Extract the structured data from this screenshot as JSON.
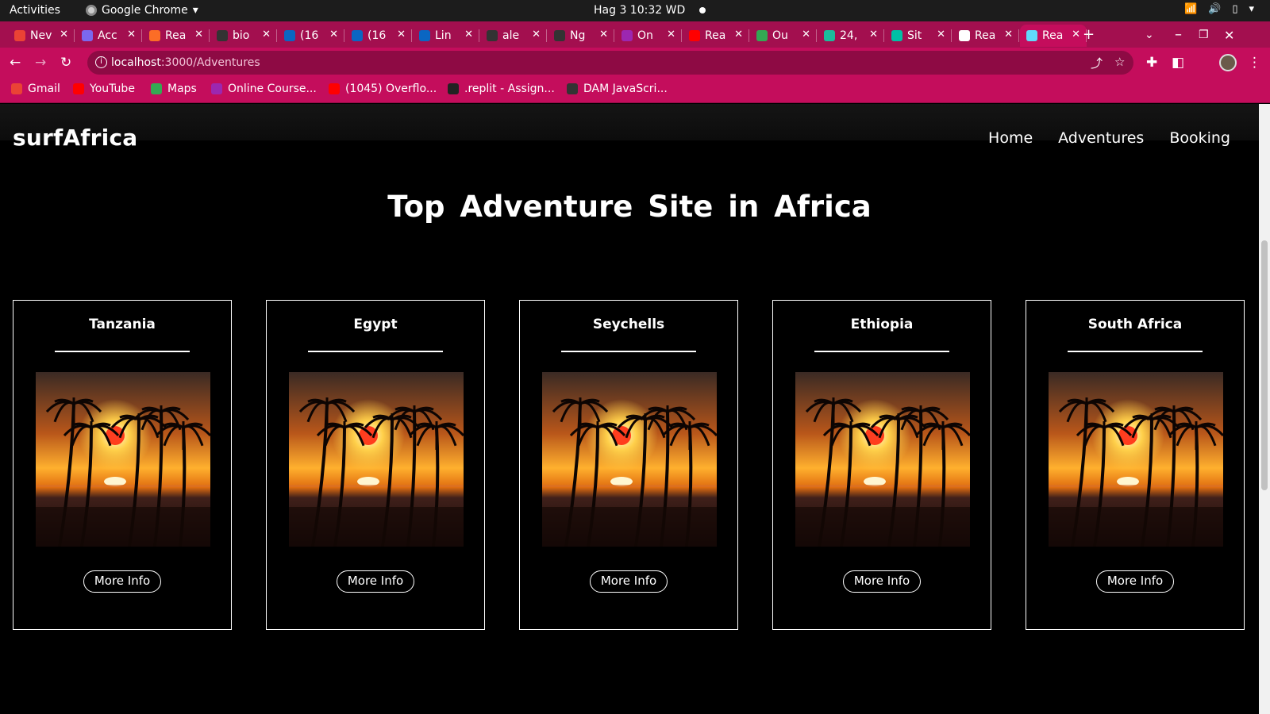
{
  "os": {
    "activities": "Activities",
    "app_name": "Google Chrome",
    "clock": "Hag 3  10:32 WD"
  },
  "browser": {
    "tabs": [
      {
        "label": "Nev",
        "icon": "gmail-icon",
        "color": "#ea4335"
      },
      {
        "label": "Acc",
        "icon": "shield-icon",
        "color": "#7b68ee"
      },
      {
        "label": "Rea",
        "icon": "gitlab-icon",
        "color": "#fc6d26"
      },
      {
        "label": "bio",
        "icon": "github-icon",
        "color": "#333333"
      },
      {
        "label": "(16",
        "icon": "linkedin-icon",
        "color": "#0a66c2"
      },
      {
        "label": "(16",
        "icon": "linkedin-icon",
        "color": "#0a66c2"
      },
      {
        "label": "Lin",
        "icon": "video-icon",
        "color": "#0a66c2"
      },
      {
        "label": "ale",
        "icon": "github-icon",
        "color": "#333333"
      },
      {
        "label": "Ng",
        "icon": "github-icon",
        "color": "#333333"
      },
      {
        "label": "On",
        "icon": "course-icon",
        "color": "#9c27b0"
      },
      {
        "label": "Rea",
        "icon": "youtube-icon",
        "color": "#ff0000"
      },
      {
        "label": "Ou",
        "icon": "drive-icon",
        "color": "#34a853"
      },
      {
        "label": "24,",
        "icon": "d-icon",
        "color": "#1abc9c"
      },
      {
        "label": "Sit",
        "icon": "diamond-icon",
        "color": "#00bfa5"
      },
      {
        "label": "Rea",
        "icon": "globe-icon",
        "color": "#ffffff"
      },
      {
        "label": "Rea",
        "icon": "react-icon",
        "color": "#61dafb"
      }
    ],
    "url_host": "localhost",
    "url_path": ":3000/Adventures",
    "bookmarks": [
      {
        "label": "Gmail",
        "icon": "gmail-icon",
        "color": "#ea4335"
      },
      {
        "label": "YouTube",
        "icon": "youtube-icon",
        "color": "#ff0000"
      },
      {
        "label": "Maps",
        "icon": "maps-icon",
        "color": "#34a853"
      },
      {
        "label": "Online Course...",
        "icon": "course-icon",
        "color": "#9c27b0"
      },
      {
        "label": "(1045) Overflo...",
        "icon": "youtube-icon",
        "color": "#ff0000"
      },
      {
        "label": ".replit - Assign...",
        "icon": "replit-icon",
        "color": "#222222"
      },
      {
        "label": "DAM JavaScri...",
        "icon": "classroom-icon",
        "color": "#333333"
      }
    ],
    "theme_color": "#c40d5c"
  },
  "site": {
    "logo": "surfAfrica",
    "nav": [
      "Home",
      "Adventures",
      "Booking"
    ],
    "heading": "Top Adventure Site in Africa",
    "cards": [
      {
        "name": "Tanzania",
        "button": "More Info"
      },
      {
        "name": "Egypt",
        "button": "More Info"
      },
      {
        "name": "Seychells",
        "button": "More Info"
      },
      {
        "name": "Ethiopia",
        "button": "More Info"
      },
      {
        "name": "South Africa",
        "button": "More Info"
      }
    ]
  }
}
